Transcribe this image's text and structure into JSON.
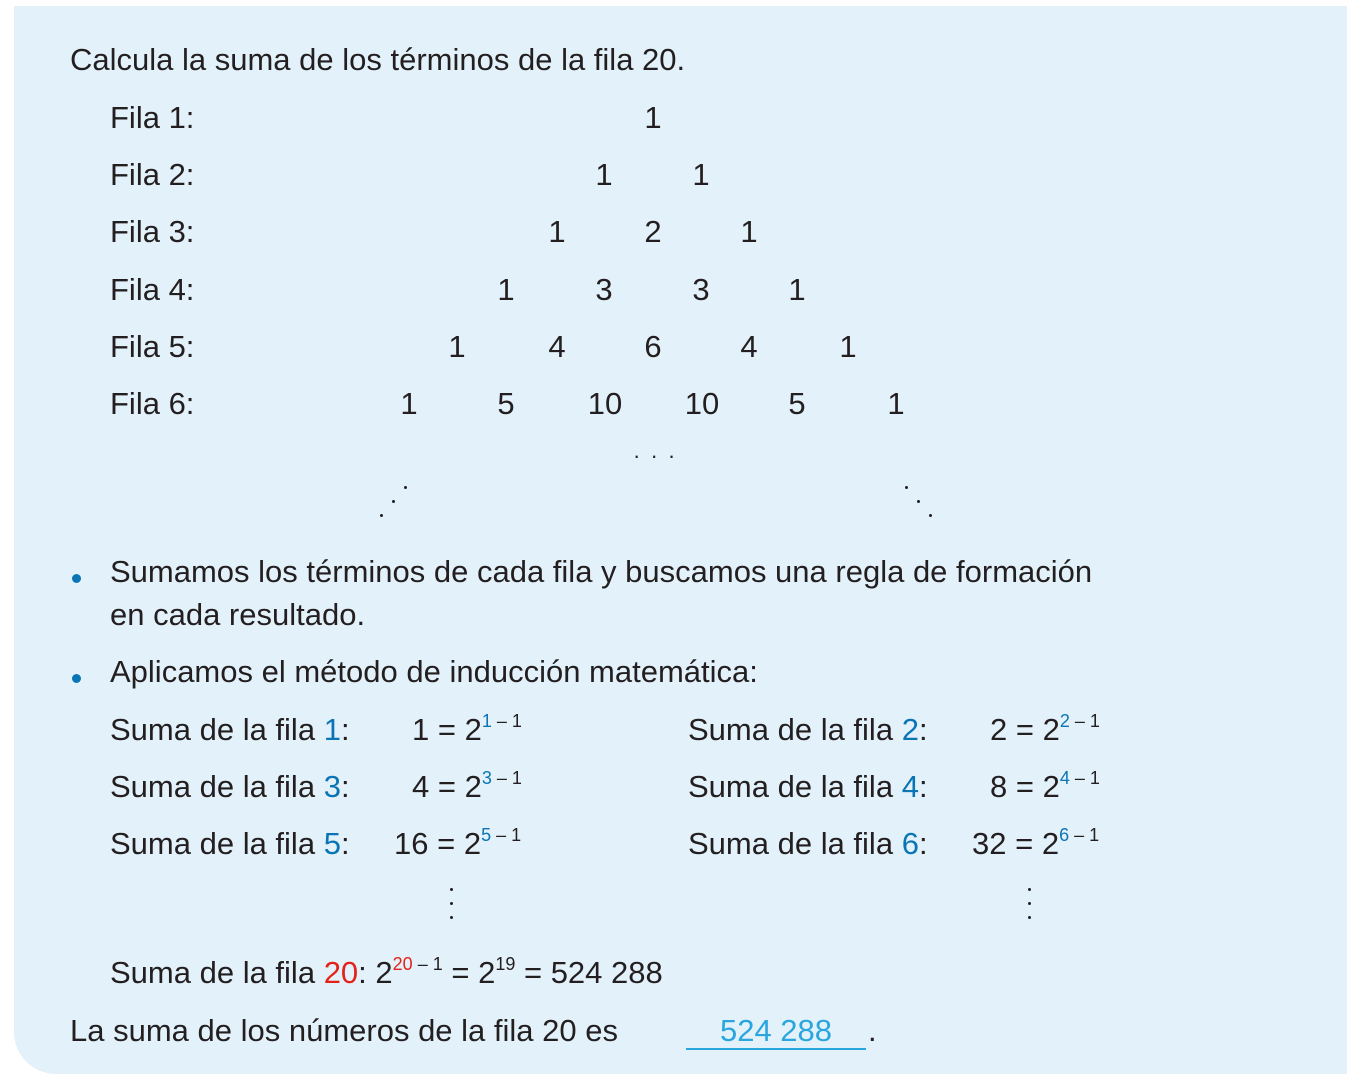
{
  "problem": {
    "statement": "Calcula la suma de los términos de la fila 20."
  },
  "triangle": {
    "rows": [
      {
        "label": "Fila 1:",
        "values": [
          "1"
        ]
      },
      {
        "label": "Fila 2:",
        "values": [
          "1",
          "1"
        ]
      },
      {
        "label": "Fila 3:",
        "values": [
          "1",
          "2",
          "1"
        ]
      },
      {
        "label": "Fila 4:",
        "values": [
          "1",
          "3",
          "3",
          "1"
        ]
      },
      {
        "label": "Fila 5:",
        "values": [
          "1",
          "4",
          "6",
          "4",
          "1"
        ]
      },
      {
        "label": "Fila 6:",
        "values": [
          "1",
          "5",
          "10",
          "10",
          "5",
          "1"
        ]
      }
    ],
    "ellipsis": "· · ·"
  },
  "steps": {
    "step1_line1": "Sumamos los términos de cada fila y buscamos una regla de formación",
    "step1_line2": "en cada resultado.",
    "step2": "Aplicamos el método de inducción matemática:"
  },
  "sums": {
    "prefix": "Suma de la fila",
    "items": [
      {
        "row": "1",
        "value": "1",
        "base": "2",
        "exp_row": "1",
        "exp_tail": " – 1"
      },
      {
        "row": "2",
        "value": "2",
        "base": "2",
        "exp_row": "2",
        "exp_tail": " – 1"
      },
      {
        "row": "3",
        "value": "4",
        "base": "2",
        "exp_row": "3",
        "exp_tail": " – 1"
      },
      {
        "row": "4",
        "value": "8",
        "base": "2",
        "exp_row": "4",
        "exp_tail": " – 1"
      },
      {
        "row": "5",
        "value": "16",
        "base": "2",
        "exp_row": "5",
        "exp_tail": " – 1"
      },
      {
        "row": "6",
        "value": "32",
        "base": "2",
        "exp_row": "6",
        "exp_tail": " – 1"
      }
    ],
    "final": {
      "row": "20",
      "base": "2",
      "exp_row": "20",
      "exp_tail": " – 1",
      "eq_base": "2",
      "eq_exp": "19",
      "result": "524 288"
    }
  },
  "conclusion": {
    "text": "La suma de los números de la fila 20 es",
    "answer": "524 288",
    "end": "."
  },
  "colors": {
    "background": "#e3f1fa",
    "blue": "#0a75b5",
    "red": "#e3231b",
    "answer": "#2aa6df"
  }
}
